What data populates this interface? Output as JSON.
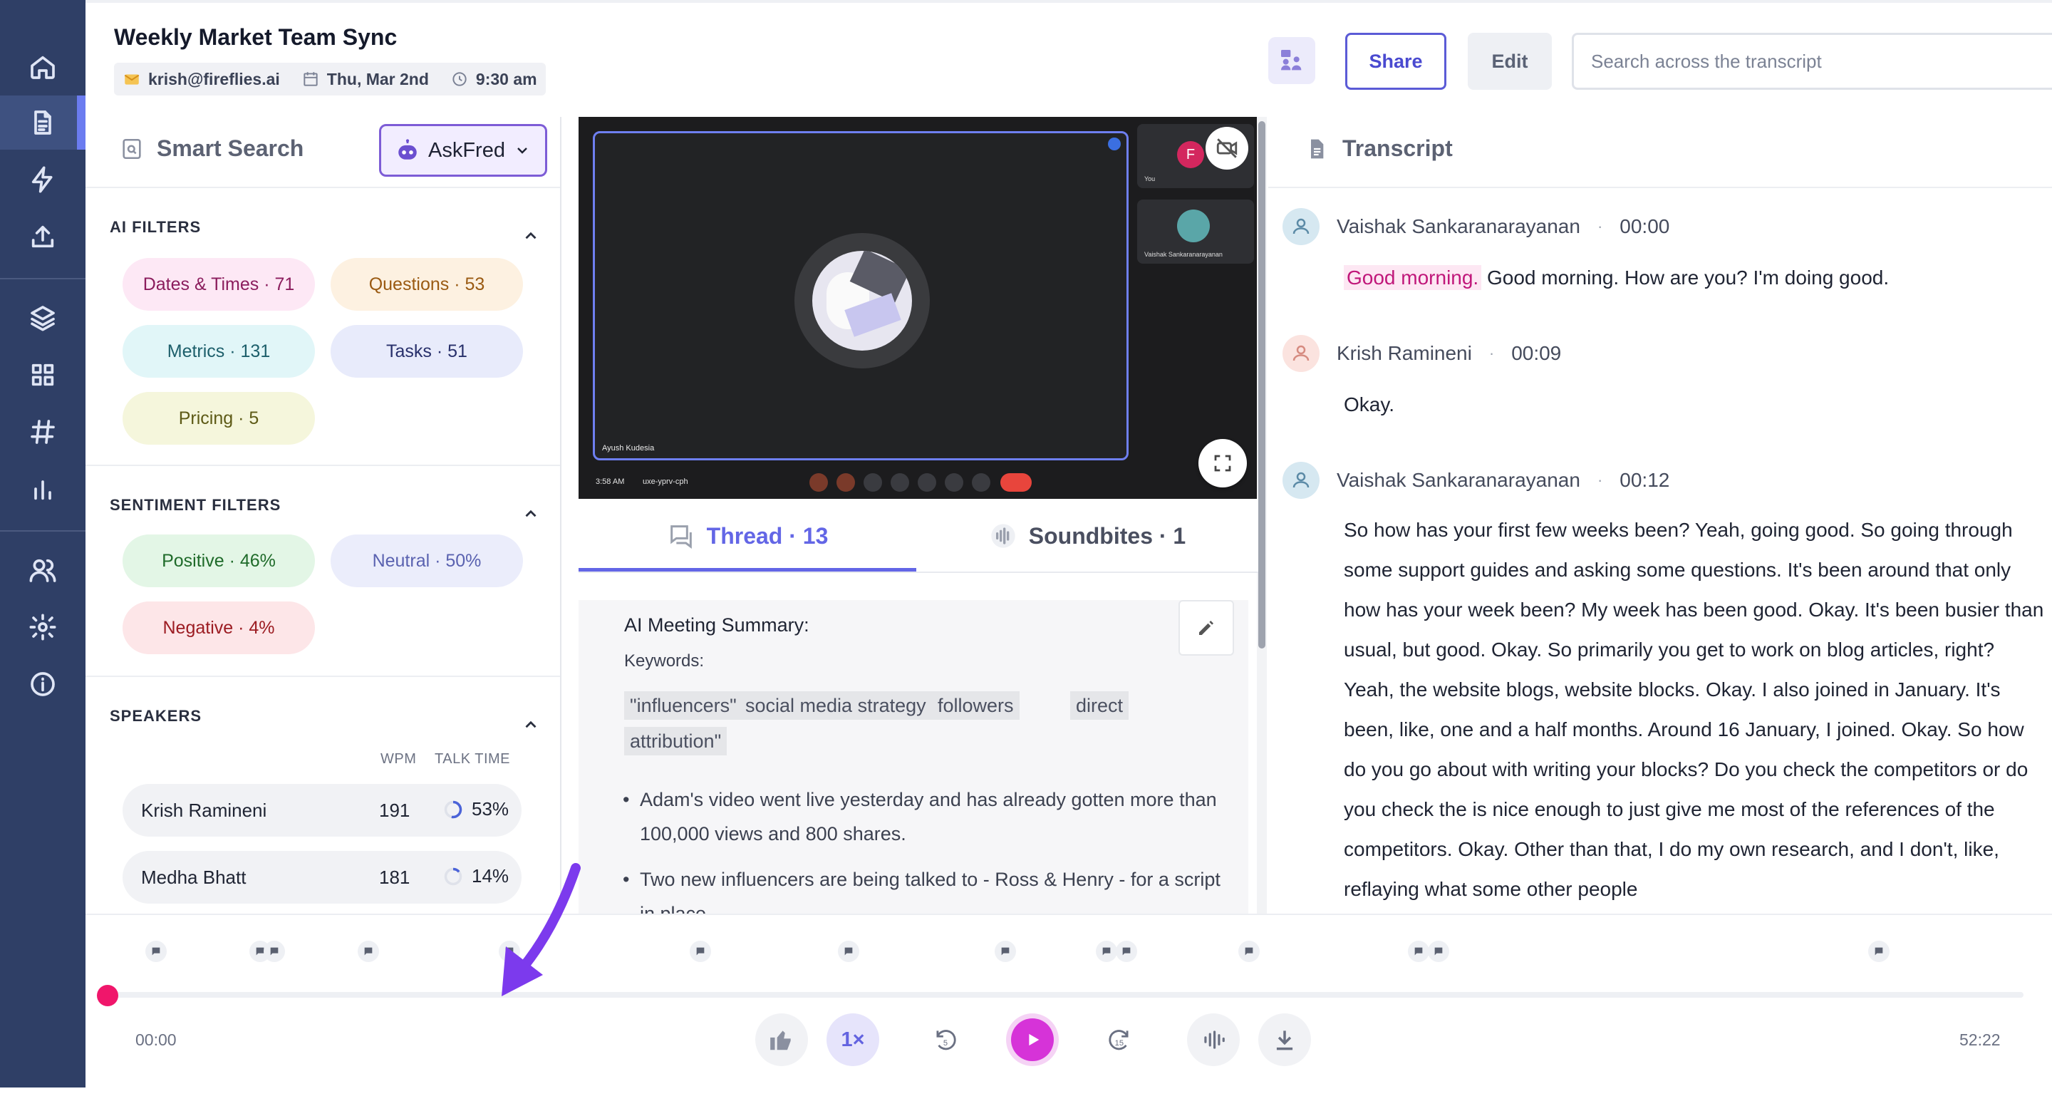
{
  "meeting": {
    "title": "Weekly Market Team Sync",
    "email": "krish@fireflies.ai",
    "date": "Thu, Mar 2nd",
    "time": "9:30 am"
  },
  "header": {
    "share_label": "Share",
    "edit_label": "Edit",
    "search_placeholder": "Search across the transcript"
  },
  "sidebar_nav": [
    "home-icon",
    "notes-icon",
    "bolt-icon",
    "upload-icon",
    "layers-icon",
    "apps-icon",
    "hashtag-icon",
    "analytics-icon",
    "team-icon",
    "settings-icon",
    "info-icon"
  ],
  "smart_search": {
    "title": "Smart Search",
    "askfred_label": "AskFred"
  },
  "ai_filters": {
    "label": "AI FILTERS",
    "items": [
      {
        "label": "Dates & Times · 71",
        "bg": "#fde8f5",
        "color": "#8b1d5d"
      },
      {
        "label": "Questions · 53",
        "bg": "#fdf1e1",
        "color": "#9a5a12"
      },
      {
        "label": "Metrics · 131",
        "bg": "#e1f6f8",
        "color": "#1d5f6b"
      },
      {
        "label": "Tasks · 51",
        "bg": "#e8ebfb",
        "color": "#28306b"
      },
      {
        "label": "Pricing · 5",
        "bg": "#f5f6dc",
        "color": "#5d5a16"
      }
    ]
  },
  "sentiment_filters": {
    "label": "SENTIMENT FILTERS",
    "items": [
      {
        "label": "Positive · 46%",
        "bg": "#e3f6e6",
        "color": "#1f6b2a"
      },
      {
        "label": "Neutral · 50%",
        "bg": "#ebedfb",
        "color": "#5a62b0"
      },
      {
        "label": "Negative · 4%",
        "bg": "#fde6e8",
        "color": "#9c1c22"
      }
    ]
  },
  "speakers": {
    "label": "SPEAKERS",
    "col_wpm": "WPM",
    "col_talk": "TALK TIME",
    "rows": [
      {
        "name": "Krish Ramineni",
        "wpm": "191",
        "talk": "53%",
        "talk_fraction": 0.53
      },
      {
        "name": "Medha Bhatt",
        "wpm": "181",
        "talk": "14%",
        "talk_fraction": 0.14
      }
    ]
  },
  "video": {
    "main_name": "Ayush Kudesia",
    "side_tile_1": "You",
    "side_tile_1_initial": "F",
    "side_tile_2": "Vaishak Sankaranarayanan",
    "clock": "3:58 AM",
    "meeting_code": "uxe-yprv-cph"
  },
  "mid_tabs": {
    "thread": "Thread · 13",
    "soundbites": "Soundbites · 1"
  },
  "summary": {
    "title": "AI Meeting Summary:",
    "keywords_label": "Keywords:",
    "keywords_line1": [
      "\"influencers\"",
      "social media strategy",
      "followers",
      "direct"
    ],
    "keywords_line2": [
      "attribution\""
    ],
    "bullets": [
      "Adam's video went live yesterday and has already gotten more than 100,000 views and 800 shares.",
      "Two new influencers are being talked to - Ross & Henry - for a script in place."
    ]
  },
  "transcript": {
    "title": "Transcript",
    "entries": [
      {
        "speaker": "Vaishak Sankaranarayanan",
        "time": "00:00",
        "highlight": "Good morning.",
        "text": " Good morning. How are you? I'm doing good."
      },
      {
        "speaker": "Krish Ramineni",
        "time": "00:09",
        "highlight": "",
        "text": "Okay."
      },
      {
        "speaker": "Vaishak Sankaranarayanan",
        "time": "00:12",
        "highlight": "",
        "text": "So how has your first few weeks been? Yeah, going good. So going through some support guides and asking some questions. It's been around that only how has your week been? My week has been good. Okay. It's been busier than usual, but good. Okay. So primarily you get to work on blog articles, right? Yeah, the website blogs, website blocks. Okay. I also joined in January. It's been, like, one and a half months. Around 16 January, I joined. Okay. So how do you go about with writing your blocks? Do you check the competitors or do you check the is nice enough to just give me most of the references of the competitors. Okay. Other than that, I do my own research, and I don't, like, reflaying what some other people"
      }
    ]
  },
  "player": {
    "current_time": "00:00",
    "duration": "52:22",
    "speed_label": "1×",
    "progress": 0.0,
    "rewind_label": "5",
    "forward_label": "15"
  },
  "colors": {
    "rail_bg": "#2f3f66",
    "accent": "#6366e6",
    "playhead": "#f0166b",
    "play_button": "#d633d8"
  }
}
